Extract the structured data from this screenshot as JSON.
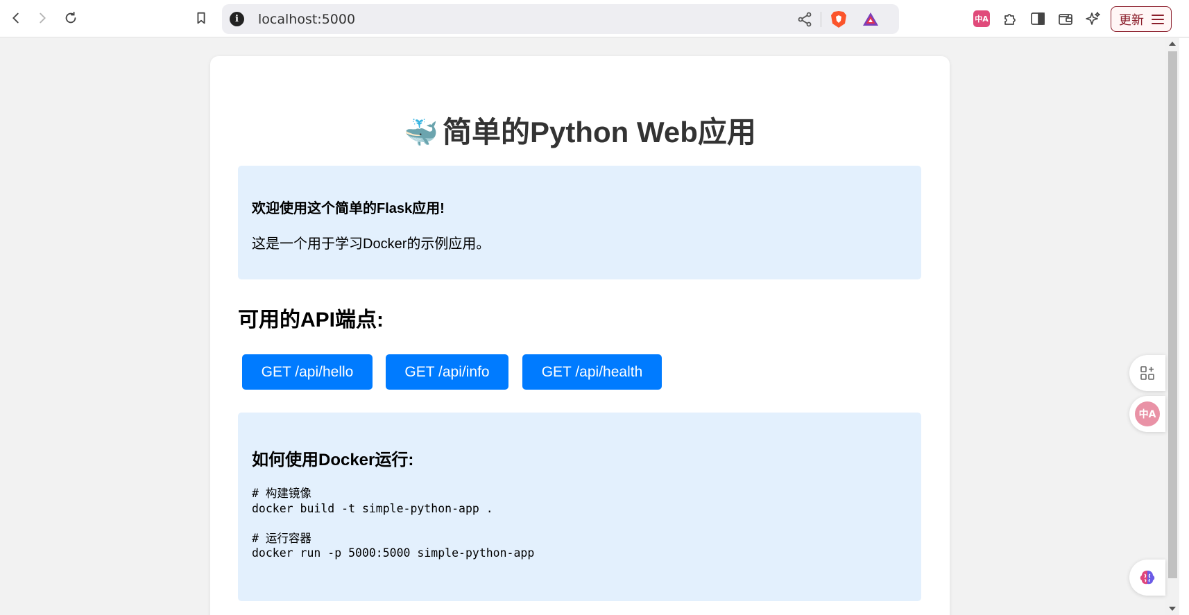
{
  "browser": {
    "url": "localhost:5000",
    "info_icon": "i",
    "update_label": "更新"
  },
  "page": {
    "title_emoji": "🐳",
    "title": "简单的Python Web应用",
    "welcome": {
      "heading": "欢迎使用这个简单的Flask应用!",
      "text": "这是一个用于学习Docker的示例应用。"
    },
    "api_heading": "可用的API端点:",
    "api_buttons": [
      {
        "label": "GET /api/hello"
      },
      {
        "label": "GET /api/info"
      },
      {
        "label": "GET /api/health"
      }
    ],
    "docker": {
      "heading": "如何使用Docker运行:",
      "code_lines": [
        "# 构建镜像",
        "docker build -t simple-python-app .",
        "",
        "# 运行容器",
        "docker run -p 5000:5000 simple-python-app"
      ]
    }
  },
  "widgets": {
    "translate_short": "中A"
  },
  "colors": {
    "primary_button": "#007bff",
    "info_box": "#e3f0fd",
    "update_border": "#8b1e2b"
  }
}
